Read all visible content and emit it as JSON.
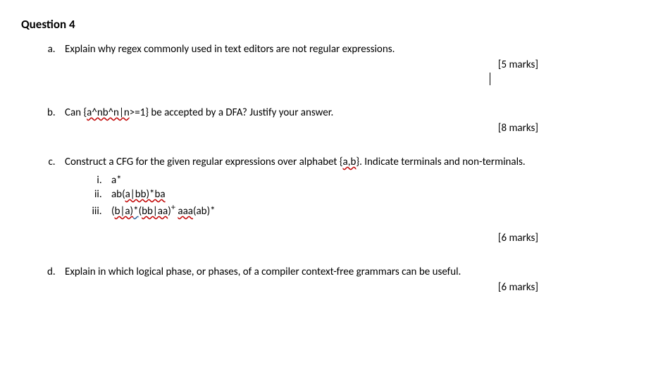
{
  "title": "Question 4",
  "parts": {
    "a": {
      "text": "Explain why regex commonly used in text editors are not regular expressions.",
      "marks": "[5 marks]"
    },
    "b": {
      "prefix": "Can {",
      "sq1": "a^nb^n|n",
      "suffix": ">=1} be accepted by a DFA? Justify your answer.",
      "marks": "[8 marks]"
    },
    "c": {
      "text_before": "Construct a CFG for the given regular expressions over alphabet {",
      "sq_ab": "a,b",
      "text_after": "}. Indicate terminals and non-terminals.",
      "i": "a*",
      "ii_p1": "ab(",
      "ii_sq1": "a|bb)*ba",
      "iii_p1": "(",
      "iii_sq1": "b|a)",
      "iii_blue": "*",
      "iii_p2": "(",
      "iii_sq2": "bb|aa",
      "iii_p3": ")",
      "iii_sup": "+",
      "iii_p4": " ",
      "iii_sq3": "aaa",
      "iii_p5": "(ab)*",
      "marks": "[6 marks]"
    },
    "d": {
      "text": "Explain in which logical phase, or phases, of a compiler context-free grammars can be useful.",
      "marks": "[6 marks]"
    }
  }
}
